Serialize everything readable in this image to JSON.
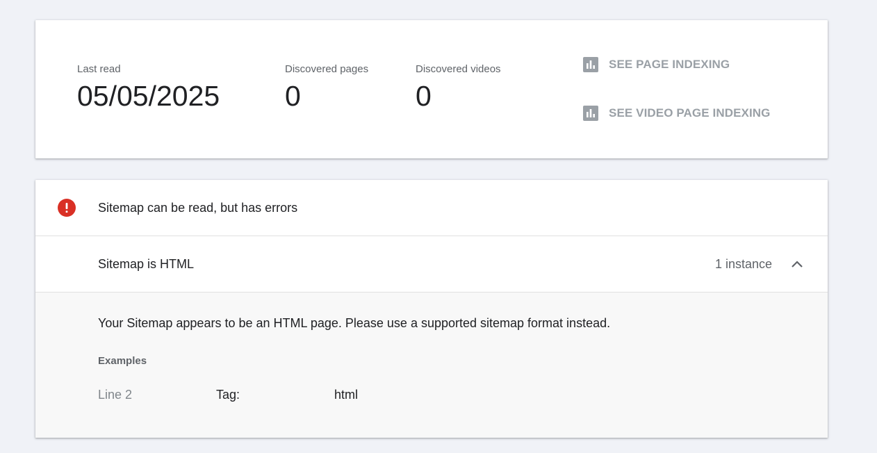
{
  "stats": {
    "last_read_label": "Last read",
    "last_read_value": "05/05/2025",
    "discovered_pages_label": "Discovered pages",
    "discovered_pages_value": "0",
    "discovered_videos_label": "Discovered videos",
    "discovered_videos_value": "0"
  },
  "actions": {
    "page_indexing_label": "SEE PAGE INDEXING",
    "video_page_indexing_label": "SEE VIDEO PAGE INDEXING",
    "icon": "bar-chart-icon"
  },
  "issue": {
    "status_icon": "error-icon",
    "status_color": "#d93025",
    "title": "Sitemap can be read, but has errors",
    "row": {
      "title": "Sitemap is HTML",
      "count": "1 instance",
      "expand_icon": "chevron-up-icon"
    },
    "detail": {
      "description": "Your Sitemap appears to be an HTML page. Please use a supported sitemap format instead.",
      "examples_label": "Examples",
      "examples": [
        {
          "line": "Line 2",
          "tag_label": "Tag:",
          "tag_value": "html"
        }
      ]
    }
  }
}
